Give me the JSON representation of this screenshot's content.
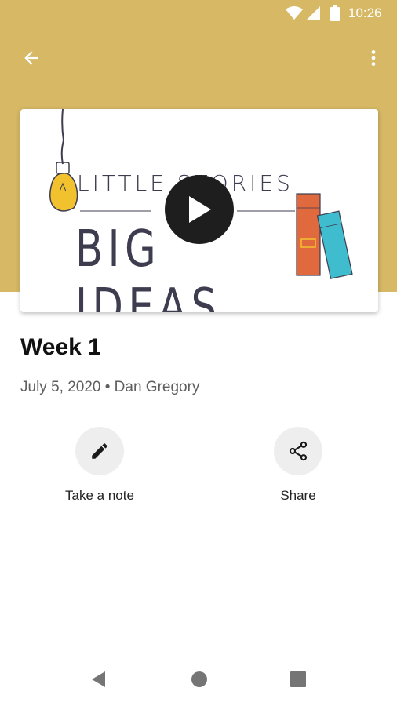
{
  "status_bar": {
    "time": "10:26",
    "icons": [
      "wifi-icon",
      "cell-signal-icon",
      "battery-icon"
    ]
  },
  "app_bar": {
    "back_icon": "arrow-left-icon",
    "menu_icon": "more-vert-icon"
  },
  "colors": {
    "header": "#d6b865",
    "play_button": "#1e1e1e",
    "action_circle": "#eeeeee"
  },
  "media": {
    "artwork_line1": "LITTLE STORIES",
    "artwork_line2": "BIG IDEAS",
    "play_icon": "play-icon"
  },
  "episode": {
    "title": "Week 1",
    "meta": "July 5, 2020 • Dan Gregory"
  },
  "actions": [
    {
      "label": "Take a note",
      "icon": "pencil-icon"
    },
    {
      "label": "Share",
      "icon": "share-icon"
    }
  ],
  "nav_bar": {
    "icons": [
      "back-triangle-icon",
      "home-circle-icon",
      "recents-square-icon"
    ]
  }
}
